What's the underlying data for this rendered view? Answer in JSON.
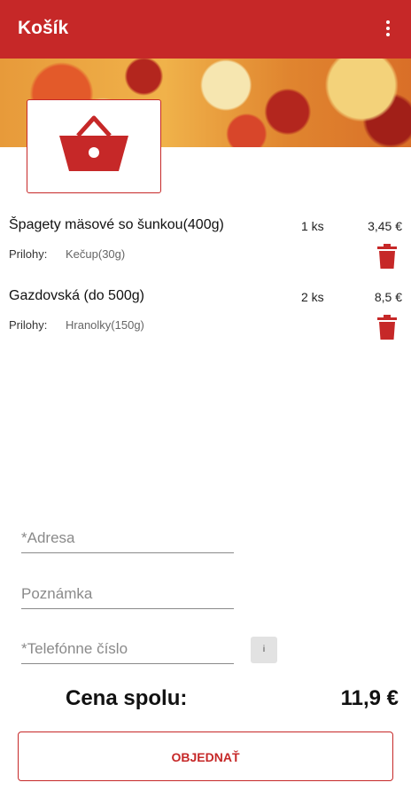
{
  "appbar": {
    "title": "Košík",
    "menu_icon": "more-vert-icon"
  },
  "banner": {
    "image": "pizza-banner"
  },
  "cart_icon": "shopping-basket-icon",
  "items": [
    {
      "name": "Špagety mäsové so šunkou(400g)",
      "qty": "1  ks",
      "price": "3,45  €",
      "sides_label": "Prilohy:",
      "sides_value": "Kečup(30g)"
    },
    {
      "name": "Gazdovská (do 500g)",
      "qty": "2  ks",
      "price": "8,5  €",
      "sides_label": "Prilohy:",
      "sides_value": "Hranolky(150g)"
    }
  ],
  "form": {
    "address_placeholder": "*Adresa",
    "note_placeholder": "Poznámka",
    "phone_placeholder": "*Telefónne číslo",
    "info_button": "i"
  },
  "total": {
    "label": "Cena spolu:",
    "value": "11,9  €"
  },
  "order_button": "OBJEDNAŤ",
  "colors": {
    "primary": "#c62828"
  }
}
